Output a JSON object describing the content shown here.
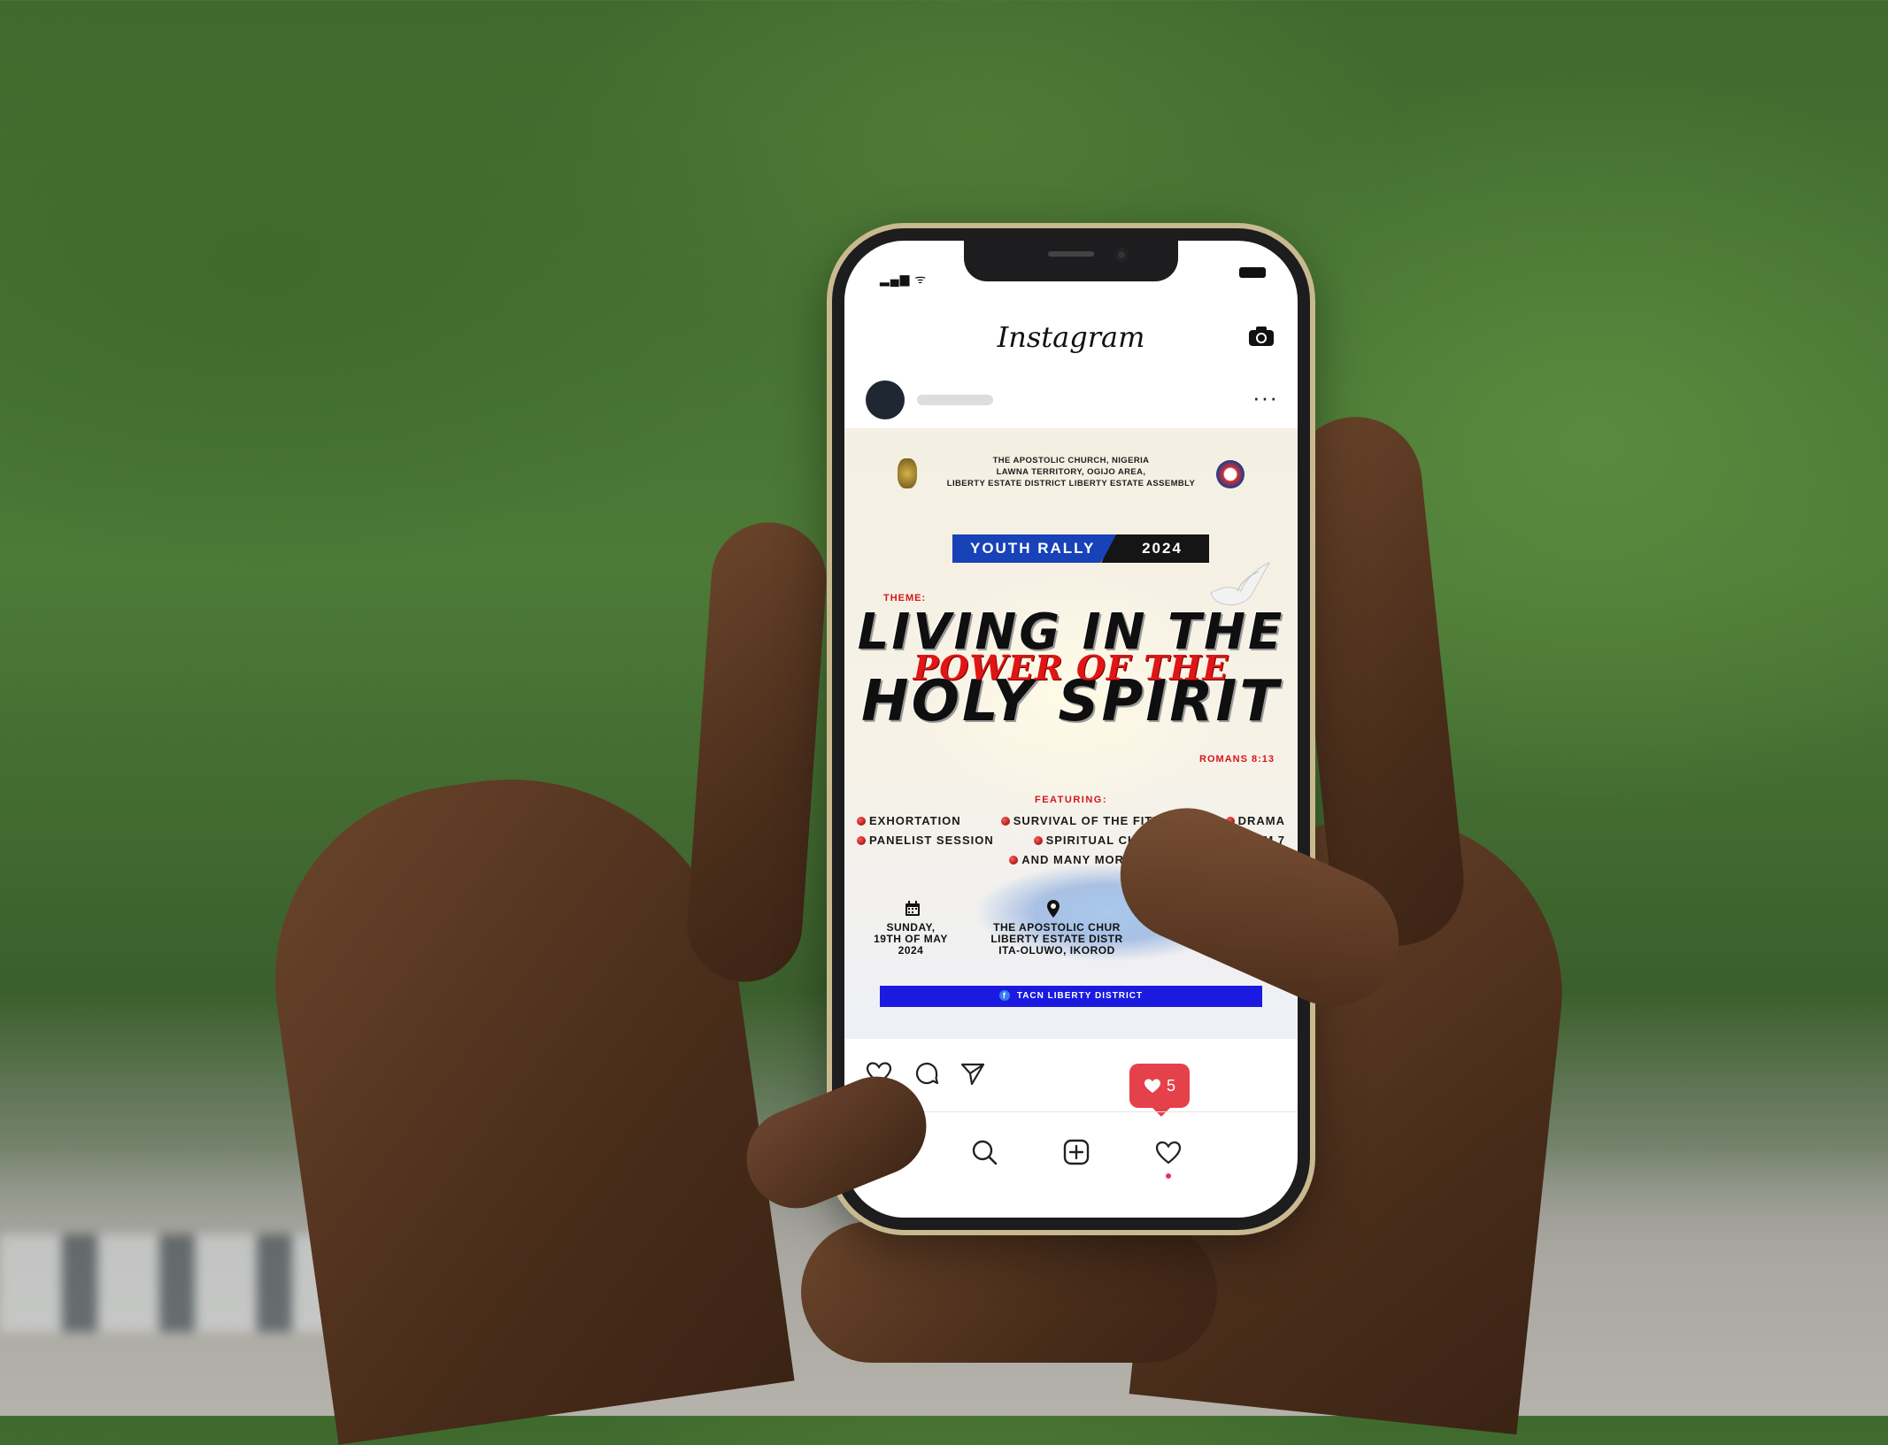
{
  "status": {
    "signal": "▂▄▆ ᯤ"
  },
  "app": {
    "logo": "Instagram"
  },
  "post": {
    "flyer": {
      "org_line1": "THE APOSTOLIC CHURCH, NIGERIA",
      "org_line2": "LAWNA TERRITORY, OGIJO AREA,",
      "org_line3": "LIBERTY ESTATE DISTRICT LIBERTY ESTATE ASSEMBLY",
      "badge_left": "YOUTH RALLY",
      "badge_right": "2024",
      "theme_label": "THEME:",
      "theme_line1": "LIVING IN THE",
      "theme_line2": "POWER OF THE",
      "theme_line3": "HOLY SPIRIT",
      "scripture": "ROMANS 8:13",
      "featuring_label": "FEATURING:",
      "features": [
        "EXHORTATION",
        "SURVIVAL OF THE FITTEST",
        "DRAMA",
        "PANELIST SESSION",
        "SPIRITUAL CHORUSES",
        "ITEM 7",
        "AND MANY MORE"
      ],
      "date_line1": "SUNDAY,",
      "date_line2": "19TH OF MAY",
      "date_line3": "2024",
      "venue_line1": "THE APOSTOLIC CHUR",
      "venue_line2": "LIBERTY ESTATE DISTR",
      "venue_line3": "ITA-OLUWO, IKOROD",
      "fb_glyph": "f",
      "facebook_handle": "TACN LIBERTY DISTRICT"
    },
    "likes_notification": "5"
  },
  "colors": {
    "accent_red": "#d8141b",
    "badge_blue": "#1842b8",
    "facebook_bar": "#1a1ae0",
    "like_bubble": "#e5414a"
  },
  "icons": {
    "header": "camera-icon",
    "post_menu": "more-icon",
    "actions": [
      "heart-icon",
      "comment-icon",
      "share-icon"
    ],
    "tabbar": [
      "search-icon",
      "add-icon",
      "activity-heart-icon"
    ]
  }
}
